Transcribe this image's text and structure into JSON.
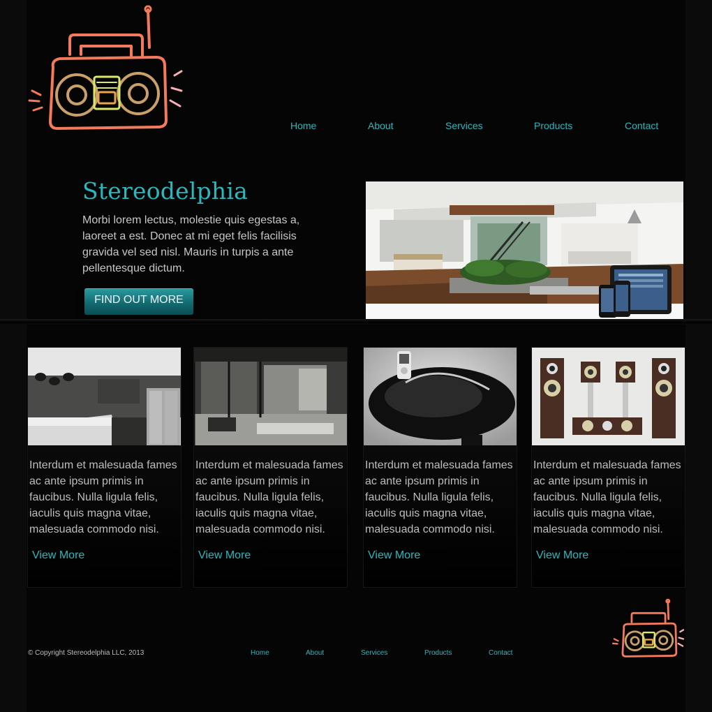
{
  "nav": {
    "home": "Home",
    "about": "About",
    "services": "Services",
    "products": "Products",
    "contact": "Contact"
  },
  "hero": {
    "title": "Stereodelphia",
    "text": "Morbi lorem lectus, molestie quis egestas a, laoreet a est. Donec at mi eget felis facilisis gravida vel sed nisl. Mauris in turpis a ante pellentesque dictum.",
    "cta_label": "FIND OUT MORE"
  },
  "cards": [
    {
      "text": "Interdum et malesuada fames ac ante ipsum primis in faucibus. Nulla ligula felis, iaculis quis magna vitae, malesuada commodo nisi.",
      "link": "View More"
    },
    {
      "text": "Interdum et malesuada fames ac ante ipsum primis in faucibus. Nulla ligula felis, iaculis quis magna vitae, malesuada commodo nisi.",
      "link": "View More"
    },
    {
      "text": "Interdum et malesuada fames ac ante ipsum primis in faucibus. Nulla ligula felis, iaculis quis magna vitae, malesuada commodo nisi.",
      "link": "View More"
    },
    {
      "text": "Interdum et malesuada fames ac ante ipsum primis in faucibus. Nulla ligula felis, iaculis quis magna vitae, malesuada commodo nisi.",
      "link": "View More"
    }
  ],
  "footer": {
    "copyright": "© Copyright Stereodelphia LLC, 2013",
    "home": "Home",
    "about": "About",
    "services": "Services",
    "products": "Products",
    "contact": "Contact"
  },
  "colors": {
    "accent": "#2ab7bd",
    "background": "#050505",
    "logo_body": "#f47a5c",
    "logo_speaker": "#c9a06a",
    "logo_display": "#d9e86a"
  },
  "icons": {
    "logo": "boombox-icon",
    "footer_logo": "boombox-icon"
  }
}
